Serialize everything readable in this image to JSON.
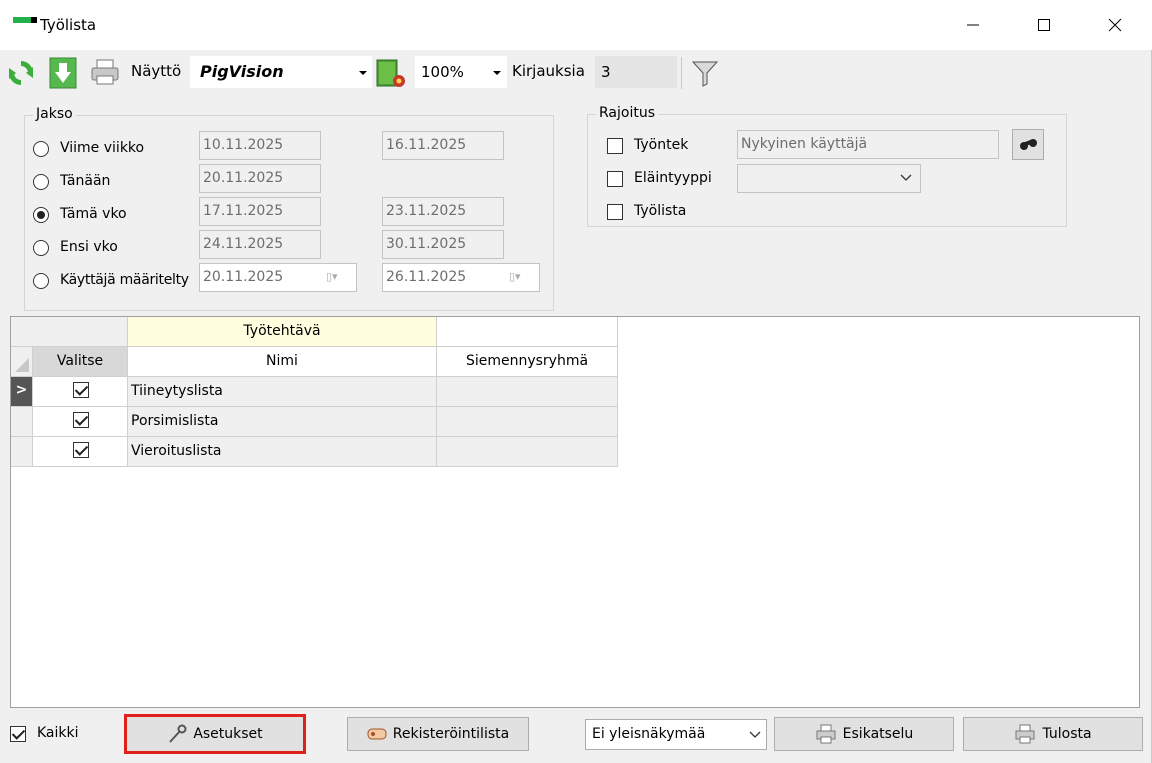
{
  "window": {
    "title": "Työlista"
  },
  "toolbar": {
    "naytto_label": "Näyttö",
    "naytto_value": "PigVision",
    "zoom_value": "100%",
    "kirjauksia_label": "Kirjauksia",
    "kirjauksia_value": "3"
  },
  "jakso": {
    "title": "Jakso",
    "options": [
      {
        "label": "Viime viikko",
        "from": "10.11.2025",
        "to": "16.11.2025",
        "selected": false
      },
      {
        "label": "Tänään",
        "from": "20.11.2025",
        "to": "",
        "selected": false
      },
      {
        "label": "Tämä vko",
        "from": "17.11.2025",
        "to": "23.11.2025",
        "selected": true
      },
      {
        "label": "Ensi vko",
        "from": "24.11.2025",
        "to": "30.11.2025",
        "selected": false
      },
      {
        "label": "Käyttäjä määritelty",
        "from": "20.11.2025",
        "to": "26.11.2025",
        "selected": false
      }
    ]
  },
  "rajoitus": {
    "title": "Rajoitus",
    "tyontek_label": "Työntek",
    "tyontek_value": "Nykyinen käyttäjä",
    "elaintyyppi_label": "Eläintyyppi",
    "elaintyyppi_value": "",
    "tyolista_label": "Työlista"
  },
  "grid": {
    "band_header": "Työtehtävä",
    "columns": [
      "Valitse",
      "Nimi",
      "Siemennysryhmä"
    ],
    "current_row_marker": ">",
    "rows": [
      {
        "selected": true,
        "name": "Tiineytyslista",
        "group": ""
      },
      {
        "selected": true,
        "name": "Porsimislista",
        "group": ""
      },
      {
        "selected": true,
        "name": "Vieroituslista",
        "group": ""
      }
    ]
  },
  "bottom": {
    "kaikki_label": "Kaikki",
    "asetukset_label": "Asetukset",
    "rekisterointilista_label": "Rekisteröintilista",
    "view_select_value": "Ei yleisnäkymää",
    "esikatselu_label": "Esikatselu",
    "tulosta_label": "Tulosta"
  },
  "colors": {
    "highlight_border": "#e0201c",
    "band_header_bg": "#ffffe0",
    "accent_green": "#22b14c"
  }
}
